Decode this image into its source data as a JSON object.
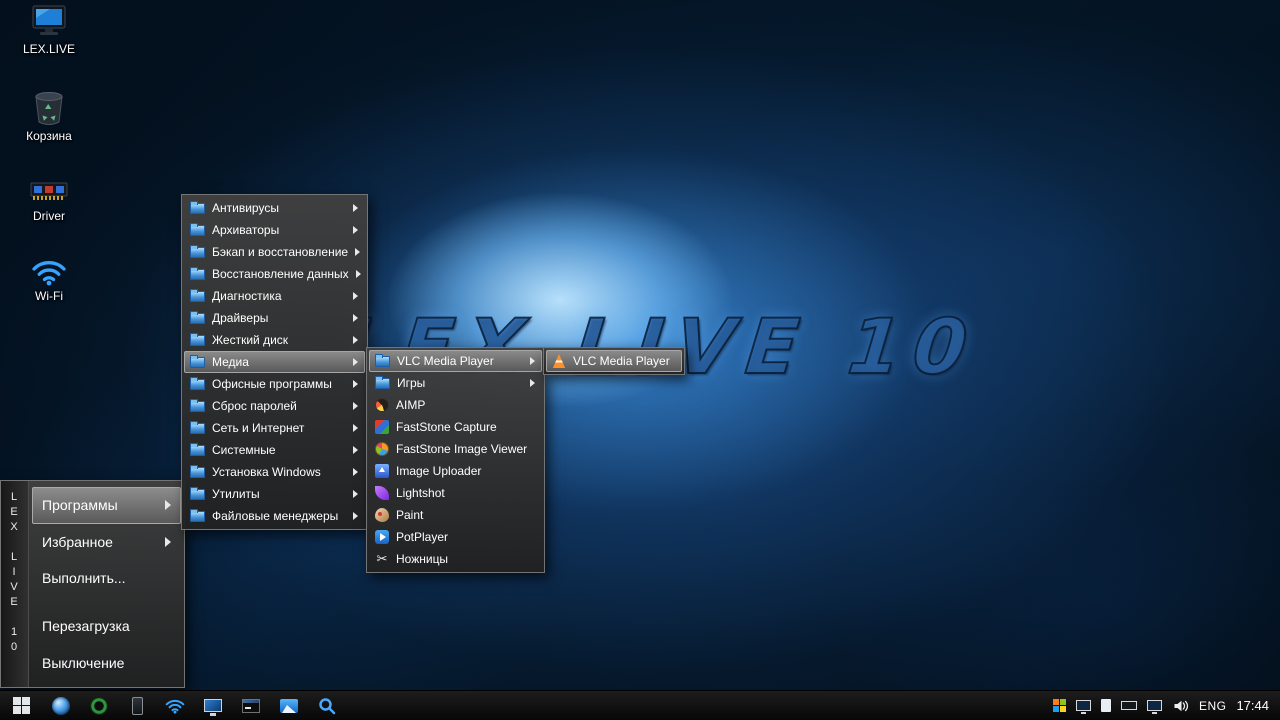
{
  "wallpaper": {
    "text": "LEX LIVE 10"
  },
  "desktop_icons": [
    {
      "label": "LEX.LIVE",
      "icon": "computer-icon"
    },
    {
      "label": "Корзина",
      "icon": "recycle-bin-icon"
    },
    {
      "label": "Driver",
      "icon": "driver-chip-icon"
    },
    {
      "label": "Wi-Fi",
      "icon": "wifi-icon"
    }
  ],
  "start_menu": {
    "side_text": "LEX LIVE 10",
    "items": [
      {
        "label": "Программы",
        "has_submenu": true,
        "selected": true
      },
      {
        "label": "Избранное",
        "has_submenu": true,
        "selected": false
      },
      {
        "label": "Выполнить...",
        "has_submenu": false,
        "selected": false
      },
      {
        "label": "Перезагрузка",
        "has_submenu": false,
        "selected": false
      },
      {
        "label": "Выключение",
        "has_submenu": false,
        "selected": false
      }
    ]
  },
  "programs_menu": {
    "items": [
      {
        "label": "Антивирусы",
        "selected": false
      },
      {
        "label": "Архиваторы",
        "selected": false
      },
      {
        "label": "Бэкап и восстановление",
        "selected": false
      },
      {
        "label": "Восстановление данных",
        "selected": false
      },
      {
        "label": "Диагностика",
        "selected": false
      },
      {
        "label": "Драйверы",
        "selected": false
      },
      {
        "label": "Жесткий диск",
        "selected": false
      },
      {
        "label": "Медиа",
        "selected": true
      },
      {
        "label": "Офисные программы",
        "selected": false
      },
      {
        "label": "Сброс паролей",
        "selected": false
      },
      {
        "label": "Сеть и Интернет",
        "selected": false
      },
      {
        "label": "Системные",
        "selected": false
      },
      {
        "label": "Установка Windows",
        "selected": false
      },
      {
        "label": "Утилиты",
        "selected": false
      },
      {
        "label": "Файловые менеджеры",
        "selected": false
      }
    ]
  },
  "media_menu": {
    "items": [
      {
        "label": "VLC Media Player",
        "type": "folder",
        "selected": true
      },
      {
        "label": "Игры",
        "type": "folder",
        "selected": false
      },
      {
        "label": "AIMP",
        "icon": "aimp-icon",
        "selected": false
      },
      {
        "label": "FastStone Capture",
        "icon": "faststone-capture-icon",
        "selected": false
      },
      {
        "label": "FastStone Image Viewer",
        "icon": "faststone-viewer-icon",
        "selected": false
      },
      {
        "label": "Image Uploader",
        "icon": "image-uploader-icon",
        "selected": false
      },
      {
        "label": "Lightshot",
        "icon": "lightshot-icon",
        "selected": false
      },
      {
        "label": "Paint",
        "icon": "paint-icon",
        "selected": false
      },
      {
        "label": "PotPlayer",
        "icon": "potplayer-icon",
        "selected": false
      },
      {
        "label": "Ножницы",
        "icon": "scissors-icon",
        "selected": false
      }
    ]
  },
  "vlc_menu": {
    "items": [
      {
        "label": "VLC Media Player",
        "icon": "vlc-cone-icon",
        "selected": true
      }
    ]
  },
  "taskbar": {
    "quick_launch": [
      {
        "icon": "browser-globe-icon"
      },
      {
        "icon": "disc-icon"
      },
      {
        "icon": "phone-device-icon"
      },
      {
        "icon": "wifi-icon"
      },
      {
        "icon": "display-icon"
      },
      {
        "icon": "cmd-icon"
      },
      {
        "icon": "photo-viewer-icon"
      },
      {
        "icon": "search-icon"
      }
    ],
    "tray": {
      "icons": [
        {
          "icon": "hardware-colors-icon"
        },
        {
          "icon": "display-icon"
        },
        {
          "icon": "document-icon"
        },
        {
          "icon": "keyboard-icon"
        },
        {
          "icon": "display-2-icon"
        },
        {
          "icon": "volume-icon"
        }
      ],
      "language": "ENG",
      "time": "17:44"
    }
  }
}
